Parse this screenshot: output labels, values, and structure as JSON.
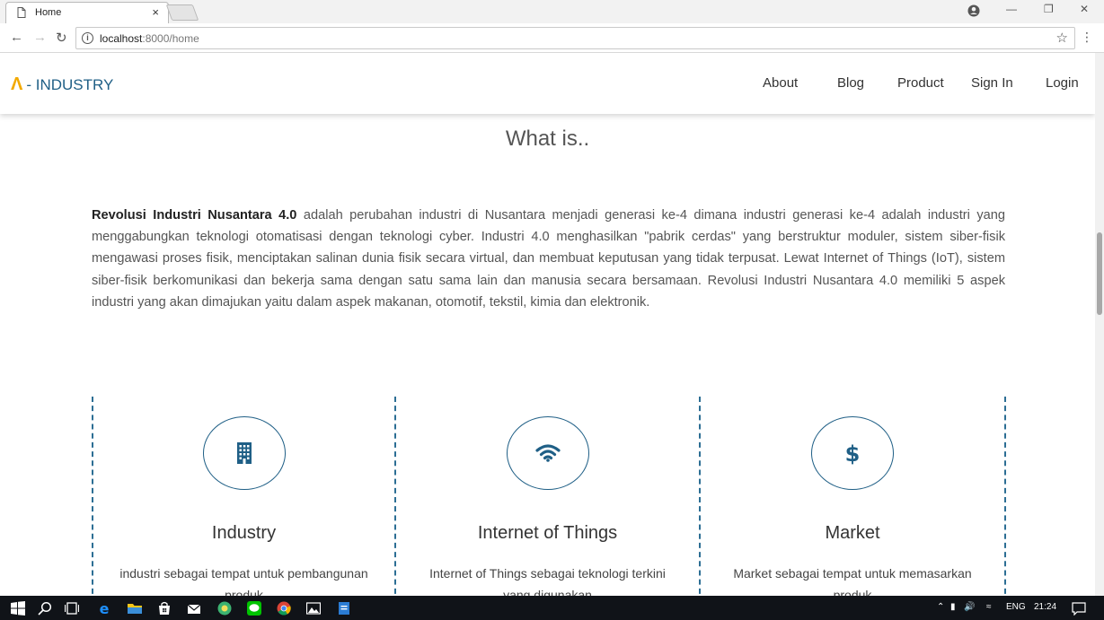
{
  "browser": {
    "tab_title": "Home",
    "tab_close": "×",
    "url_host": "localhost",
    "url_path": ":8000/home"
  },
  "site": {
    "logo_mark": "Λ",
    "logo_text": "- INDUSTRY",
    "nav": [
      "About",
      "Blog",
      "Product",
      "Sign In",
      "Login"
    ]
  },
  "section": {
    "title": "What is..",
    "intro_bold": "Revolusi Industri Nusantara 4.0",
    "intro_rest": " adalah perubahan industri di Nusantara menjadi generasi ke-4 dimana industri generasi ke-4 adalah industri yang menggabungkan teknologi otomatisasi dengan teknologi cyber. Industri 4.0 menghasilkan \"pabrik cerdas\" yang berstruktur moduler, sistem siber-fisik mengawasi proses fisik, menciptakan salinan dunia fisik secara virtual, dan membuat keputusan yang tidak terpusat. Lewat Internet of Things (IoT), sistem siber-fisik berkomunikasi dan bekerja sama dengan satu sama lain dan manusia secara bersamaan. Revolusi Industri Nusantara 4.0 memiliki 5 aspek industri yang akan dimajukan yaitu dalam aspek makanan, otomotif, tekstil, kimia dan elektronik."
  },
  "features": [
    {
      "icon": "building-icon",
      "title": "Industry",
      "desc": "industri sebagai tempat untuk pembangunan produk"
    },
    {
      "icon": "wifi-icon",
      "title": "Internet of Things",
      "desc": "Internet of Things sebagai teknologi terkini yang digunakan"
    },
    {
      "icon": "dollar-icon",
      "title": "Market",
      "desc": "Market sebagai tempat untuk memasarkan produk"
    }
  ],
  "taskbar": {
    "lang": "ENG",
    "time": "21:24"
  },
  "colors": {
    "brand_blue": "#1f5f86",
    "logo_yellow": "#f2a900"
  }
}
